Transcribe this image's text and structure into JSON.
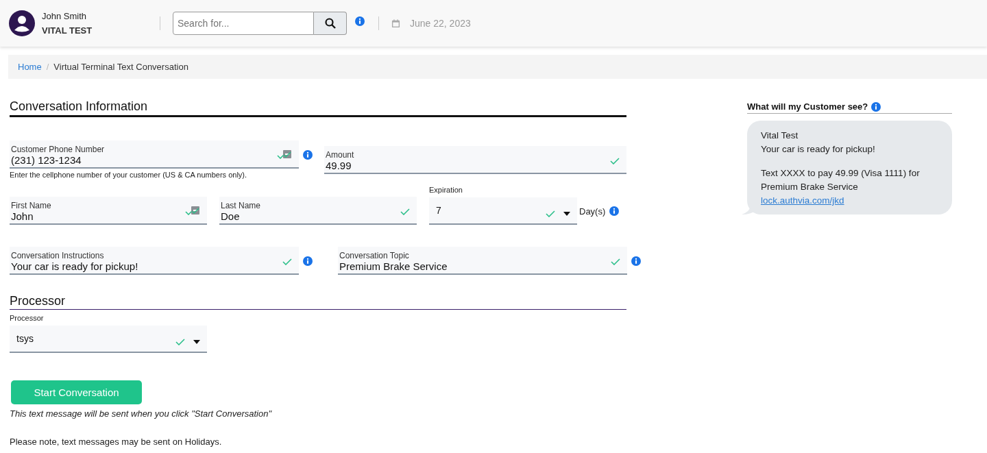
{
  "header": {
    "user_name": "John Smith",
    "company": "VITAL TEST",
    "search": {
      "placeholder": "Search for..."
    },
    "date": "June 22, 2023"
  },
  "breadcrumb": {
    "separator": "/",
    "items": [
      {
        "label": "Home",
        "link": true
      },
      {
        "label": "Virtual Terminal Text Conversation",
        "link": false
      }
    ]
  },
  "conversation_section": {
    "title": "Conversation Information",
    "phone": {
      "label": "Customer Phone Number",
      "value": "(231) 123-1234",
      "valid": true,
      "autofill": true,
      "info": true,
      "hint": "Enter the cellphone number of your customer (US & CA numbers only)."
    },
    "amount": {
      "label": "Amount",
      "value": "49.99",
      "valid": true
    },
    "first_name": {
      "label": "First Name",
      "value": "John",
      "valid": true,
      "autofill": true
    },
    "last_name": {
      "label": "Last Name",
      "value": "Doe",
      "valid": true
    },
    "expiration": {
      "label": "Expiration",
      "value": "7",
      "valid": true,
      "unit": "Day(s)",
      "info": true
    },
    "instructions": {
      "label": "Conversation Instructions",
      "value": "Your car is ready for pickup!",
      "valid": true,
      "info": true
    },
    "topic": {
      "label": "Conversation Topic",
      "value": "Premium Brake Service",
      "valid": true,
      "info": true
    }
  },
  "processor_section": {
    "title": "Processor",
    "processor": {
      "label": "Processor",
      "value": "tsys",
      "valid": true
    }
  },
  "start_button": "Start Conversation",
  "send_note": "This text message will be sent when you click \"Start Conversation\"",
  "holiday_note": "Please note, text messages may be sent on Holidays.",
  "preview": {
    "title": "What will my Customer see?",
    "lines": [
      "Vital Test",
      "Your car is ready for pickup!"
    ],
    "body": "Text XXXX to pay 49.99 (Visa 1111) for Premium Brake Service",
    "link": "lock.authvia.com/jkd"
  }
}
